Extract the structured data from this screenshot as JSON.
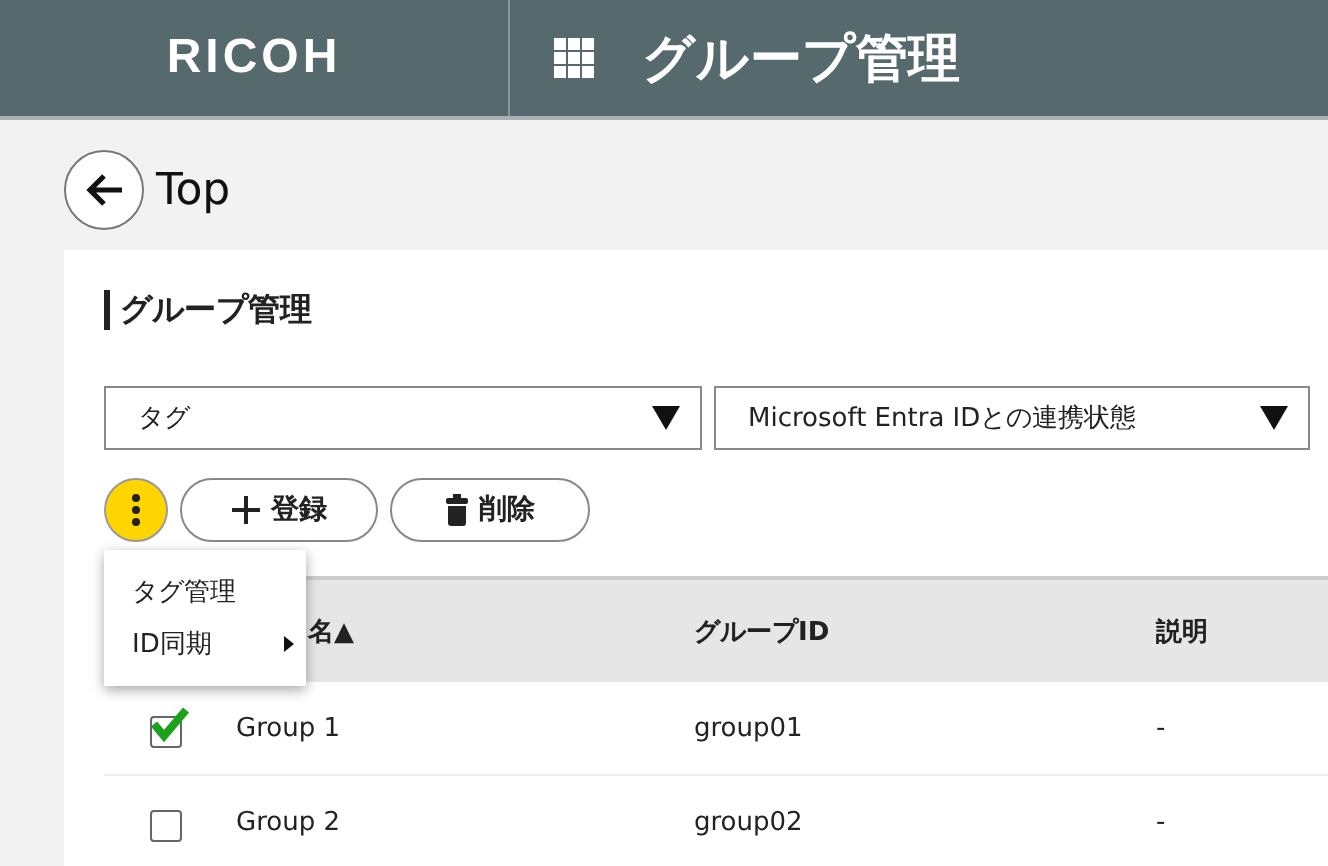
{
  "header": {
    "logo": "RICOH",
    "title": "グループ管理"
  },
  "back": {
    "label": "Top"
  },
  "card": {
    "title": "グループ管理"
  },
  "filters": [
    {
      "value": "タグ"
    },
    {
      "value": "Microsoft Entra IDとの連携状態"
    }
  ],
  "toolbar": {
    "more_open": true,
    "buttons": [
      {
        "kind": "add",
        "label": "登録"
      },
      {
        "kind": "delete",
        "label": "削除"
      }
    ]
  },
  "menu": {
    "items": [
      {
        "label": "タグ管理",
        "has_submenu": false
      },
      {
        "label": "ID同期",
        "has_submenu": true
      }
    ]
  },
  "table": {
    "columns": [
      "名▲",
      "グループID",
      "説明"
    ],
    "rows": [
      {
        "checked": true,
        "cells": [
          "Group 1",
          "group01",
          "-"
        ]
      },
      {
        "checked": false,
        "cells": [
          "Group 2",
          "group02",
          "-"
        ]
      }
    ]
  }
}
